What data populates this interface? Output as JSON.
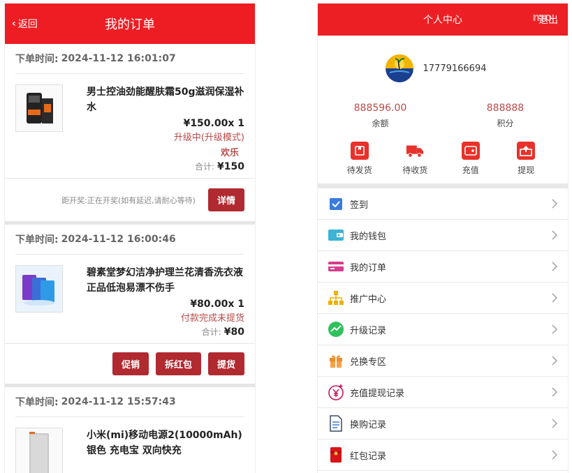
{
  "colors": {
    "header_red": "#ee1d23",
    "button_red": "#b02a30",
    "status_red": "#b84a4a"
  },
  "left": {
    "back_label": "返回",
    "title": "我的订单",
    "orders": [
      {
        "time_label": "下单时间:",
        "time": "2024-11-12 16:01:07",
        "name": "男士控油劲能醒肤霜50g滋润保湿补水",
        "price": "¥150.00x 1",
        "status": "升级中(升级模式)",
        "status2": "欢乐",
        "total_label": "合计:",
        "total": "¥150",
        "note": "距开奖:正在开奖(如有延迟,请耐心等待)",
        "buttons": [
          "详情"
        ]
      },
      {
        "time_label": "下单时间:",
        "time": "2024-11-12 16:00:46",
        "name": "碧素堂梦幻洁净护理兰花清香洗衣液正品低泡易漂不伤手",
        "price": "¥80.00x 1",
        "status": "付款完成未提货",
        "total_label": "合计:",
        "total": "¥80",
        "buttons": [
          "促销",
          "拆红包",
          "提货"
        ]
      },
      {
        "time_label": "下单时间:",
        "time": "2024-11-12 15:57:43",
        "name": "小米(mi)移动电源2(10000mAh)银色 充电宝 双向快充"
      }
    ]
  },
  "right": {
    "title": "个人中心",
    "logout": "退出",
    "watermark": "mo",
    "phone": "17779166694",
    "stats": [
      {
        "value": "888596.00",
        "label": "余额"
      },
      {
        "value": "888888",
        "label": "积分"
      }
    ],
    "quick": [
      {
        "label": "待发货",
        "icon": "package-icon"
      },
      {
        "label": "待收货",
        "icon": "truck-icon"
      },
      {
        "label": "充值",
        "icon": "wallet-icon"
      },
      {
        "label": "提现",
        "icon": "withdraw-icon"
      }
    ],
    "menu": [
      {
        "label": "签到",
        "icon": "checkin-icon",
        "color": "#3a7be0"
      },
      {
        "label": "我的钱包",
        "icon": "wallet-icon",
        "color": "#3db3d6"
      },
      {
        "label": "我的订单",
        "icon": "card-icon",
        "color": "#d63b8d"
      },
      {
        "label": "推广中心",
        "icon": "org-chart-icon",
        "color": "#f0b000"
      },
      {
        "label": "升级记录",
        "icon": "trend-icon",
        "color": "#2fc25b"
      },
      {
        "label": "兑换专区",
        "icon": "gift-icon",
        "color": "#f08a24"
      },
      {
        "label": "充值提现记录",
        "icon": "yen-icon",
        "color": "#c2185b"
      },
      {
        "label": "换购记录",
        "icon": "document-icon",
        "color": "#3a7be0"
      },
      {
        "label": "红包记录",
        "icon": "red-packet-icon",
        "color": "#d8141a"
      }
    ]
  }
}
